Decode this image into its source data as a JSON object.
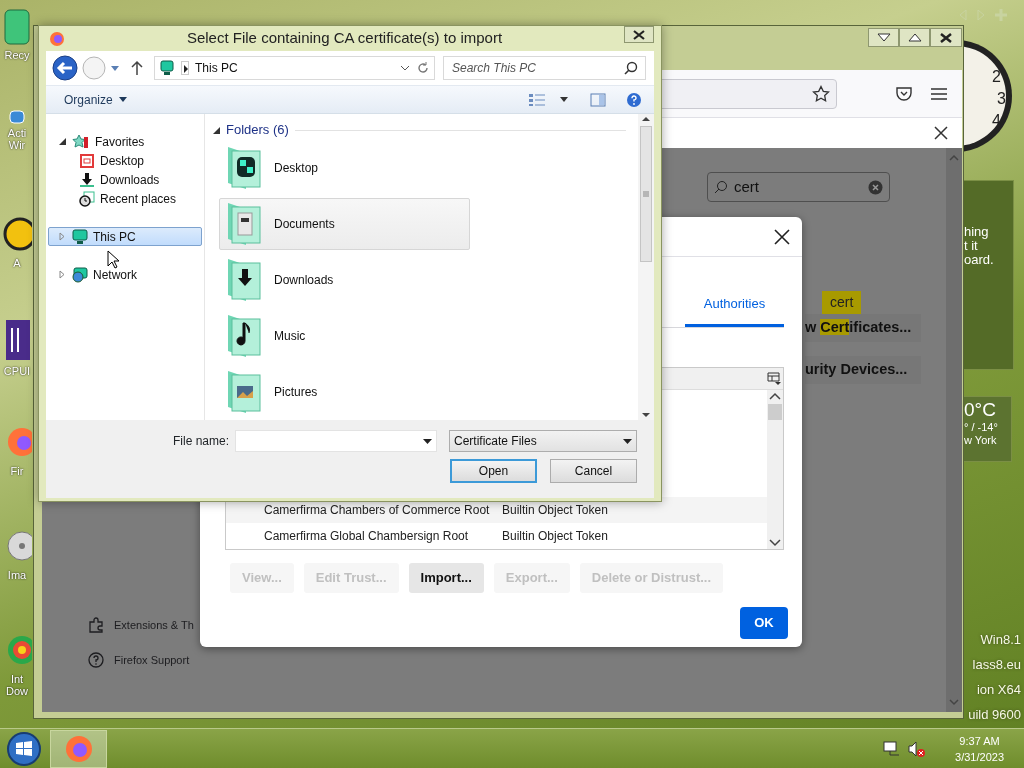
{
  "desktop": {
    "icons": [
      {
        "kind": "recycle",
        "label": "Recy"
      },
      {
        "kind": "shortcut",
        "label": "Acti Wir"
      },
      {
        "kind": "yellow",
        "label": "A"
      },
      {
        "kind": "chip",
        "label": "CPUI"
      },
      {
        "kind": "fox",
        "label": "Fir"
      },
      {
        "kind": "disc",
        "label": "Ima"
      },
      {
        "kind": "rainbow",
        "label": "Int Dow"
      }
    ],
    "wallpaper_text": [
      "Win8.1",
      "lass8.eu",
      "ion X64",
      "uild 9600"
    ]
  },
  "gadgets": {
    "clock": {
      "numerals": [
        "2",
        "3",
        "4"
      ]
    },
    "note": {
      "lines": [
        "hing",
        "t it",
        "oard."
      ]
    },
    "weather": {
      "temperature": "0°C",
      "range": "° / -14°",
      "city": "w York"
    }
  },
  "firefox": {
    "search": {
      "value": "cert"
    },
    "tooltip": "cert",
    "buttons": [
      {
        "parts": [
          {
            "text": "w ",
            "match": false
          },
          {
            "text": "Cert",
            "match": true
          },
          {
            "text": "ificates...",
            "match": false
          }
        ]
      },
      {
        "parts": [
          {
            "text": "urity Devices...",
            "match": false
          }
        ]
      }
    ],
    "sidebar": [
      {
        "kind": "extensions",
        "label": "Extensions & Th"
      },
      {
        "kind": "support",
        "label": "Firefox Support"
      }
    ]
  },
  "cert_manager": {
    "tabs": [
      {
        "label": "Authorities",
        "selected": true
      }
    ],
    "rows": [
      {
        "name": "Camerfirma Chambers of Commerce Root",
        "token": "Builtin Object Token"
      },
      {
        "name": "Camerfirma Global Chambersign Root",
        "token": "Builtin Object Token"
      }
    ],
    "buttons": [
      {
        "label": "View...",
        "disabled": true
      },
      {
        "label": "Edit Trust...",
        "disabled": true
      },
      {
        "label": "Import...",
        "disabled": false
      },
      {
        "label": "Export...",
        "disabled": true
      },
      {
        "label": "Delete or Distrust...",
        "disabled": true
      }
    ],
    "ok": "OK"
  },
  "file_dialog": {
    "title": "Select File containing CA certificate(s) to import",
    "address": "This PC",
    "search": {
      "placeholder": "Search This PC"
    },
    "organize": "Organize",
    "nav": [
      {
        "kind": "favorites",
        "label": "Favorites",
        "expanded": true,
        "selected": false,
        "children": [
          {
            "kind": "desktop",
            "label": "Desktop",
            "selected": false
          },
          {
            "kind": "downloads",
            "label": "Downloads",
            "selected": false
          },
          {
            "kind": "recent",
            "label": "Recent places",
            "selected": false
          }
        ]
      },
      {
        "kind": "pc",
        "label": "This PC",
        "expanded": false,
        "selected": true
      },
      {
        "kind": "network",
        "label": "Network",
        "expanded": false,
        "selected": false
      }
    ],
    "group": {
      "title": "Folders (6)",
      "expanded": true
    },
    "folders": [
      {
        "kind": "desktop",
        "label": "Desktop",
        "hot": false
      },
      {
        "kind": "documents",
        "label": "Documents",
        "hot": true
      },
      {
        "kind": "downloads",
        "label": "Downloads",
        "hot": false
      },
      {
        "kind": "music",
        "label": "Music",
        "hot": false
      },
      {
        "kind": "pictures",
        "label": "Pictures",
        "hot": false
      }
    ],
    "file_name_label": "File name:",
    "file_type": "Certificate Files",
    "buttons": [
      {
        "label": "Open",
        "default": true
      },
      {
        "label": "Cancel",
        "default": false
      }
    ]
  },
  "taskbar": {
    "apps": [
      {
        "kind": "firefox",
        "active": true
      }
    ],
    "tray": [
      {
        "kind": "network"
      },
      {
        "kind": "volume-muted"
      }
    ],
    "time": "9:37 AM",
    "date": "3/31/2023"
  }
}
